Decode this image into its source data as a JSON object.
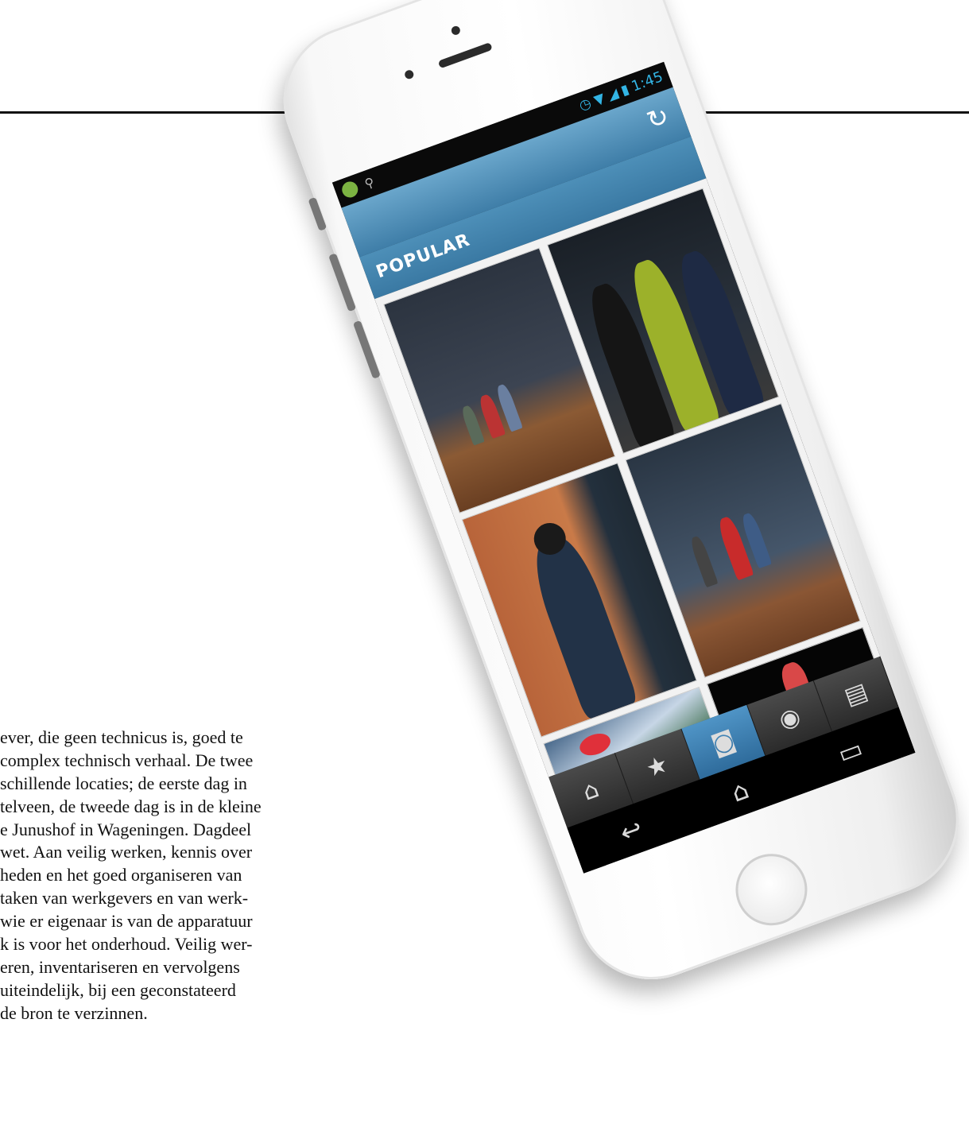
{
  "article": {
    "lines": [
      "ever, die geen technicus is, goed te",
      " complex technisch verhaal. De twee",
      "schillende locaties; de eerste dag in",
      "telveen, de tweede dag is in de kleine",
      "e Junushof in Wageningen. Dagdeel",
      "wet. Aan veilig werken, kennis over",
      "heden en het goed organiseren van",
      "taken van werkgevers en van werk-",
      "wie er eigenaar is van de apparatuur",
      "k is voor het onderhoud. Veilig wer-",
      "eren, inventariseren en vervolgens",
      " uiteindelijk, bij een geconstateerd",
      "de bron te verzinnen."
    ]
  },
  "phone": {
    "status_bar": {
      "time": "1:45",
      "left_icons": [
        "android-icon",
        "usb-icon"
      ],
      "right_icons": [
        "alarm-icon",
        "wifi-icon",
        "signal-icon",
        "battery-icon"
      ]
    },
    "action_bar": {
      "refresh_icon": "refresh-icon"
    },
    "section": {
      "title": "POPULAR"
    },
    "tabs": [
      {
        "icon": "home-icon",
        "glyph": "⌂",
        "active": false
      },
      {
        "icon": "star-icon",
        "glyph": "★",
        "active": false
      },
      {
        "icon": "instagram-icon",
        "glyph": "◙",
        "active": true
      },
      {
        "icon": "search-icon",
        "glyph": "◉",
        "active": false
      },
      {
        "icon": "news-icon",
        "glyph": "▤",
        "active": false
      }
    ],
    "nav": [
      {
        "icon": "back-icon",
        "glyph": "↩"
      },
      {
        "icon": "home-nav-icon",
        "glyph": "⌂"
      },
      {
        "icon": "recents-icon",
        "glyph": "▭"
      }
    ],
    "colors": {
      "accent": "#3f7ea8",
      "status_accent": "#33b5e5"
    }
  }
}
